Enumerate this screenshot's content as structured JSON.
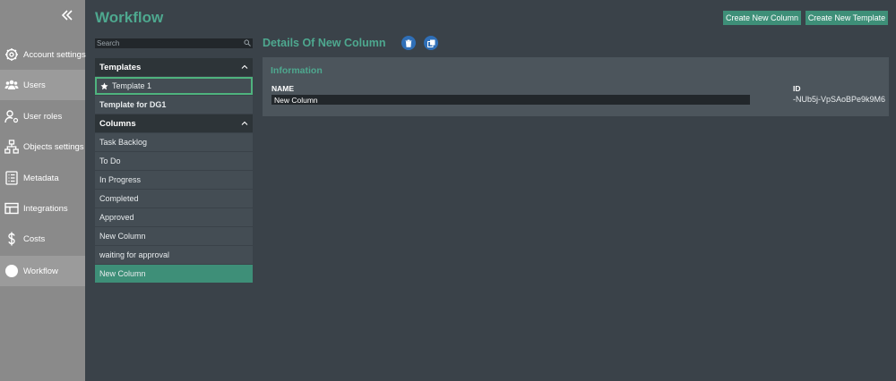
{
  "sidebar": {
    "items": [
      {
        "label": "Account settings",
        "icon": "gear-icon"
      },
      {
        "label": "Users",
        "icon": "users-icon"
      },
      {
        "label": "User roles",
        "icon": "user-roles-icon"
      },
      {
        "label": "Objects settings",
        "icon": "objects-icon"
      },
      {
        "label": "Metadata",
        "icon": "metadata-icon"
      },
      {
        "label": "Integrations",
        "icon": "integrations-icon"
      },
      {
        "label": "Costs",
        "icon": "dollar-icon"
      },
      {
        "label": "Workflow",
        "icon": "workflow-circle-icon"
      }
    ]
  },
  "header": {
    "title": "Workflow",
    "create_column_label": "Create New Column",
    "create_template_label": "Create New Template"
  },
  "search": {
    "placeholder": "Search"
  },
  "templates": {
    "title": "Templates",
    "items": [
      "Template 1",
      "Template for DG1"
    ]
  },
  "columns": {
    "title": "Columns",
    "items": [
      "Task Backlog",
      "To Do",
      "In Progress",
      "Completed",
      "Approved",
      "New Column",
      "waiting for approval",
      "New Column"
    ]
  },
  "details": {
    "title": "Details Of New Column",
    "section_title": "Information",
    "name_label": "NAME",
    "name_value": "New Column",
    "id_label": "ID",
    "id_value": "-NUb5j-VpSAoBPe9k9M6"
  },
  "colors": {
    "accent": "#4ea88f",
    "button": "#3e8f78",
    "background": "#3a4249",
    "sidebar": "#8a8a8a",
    "selected_border": "#4fb37e"
  }
}
